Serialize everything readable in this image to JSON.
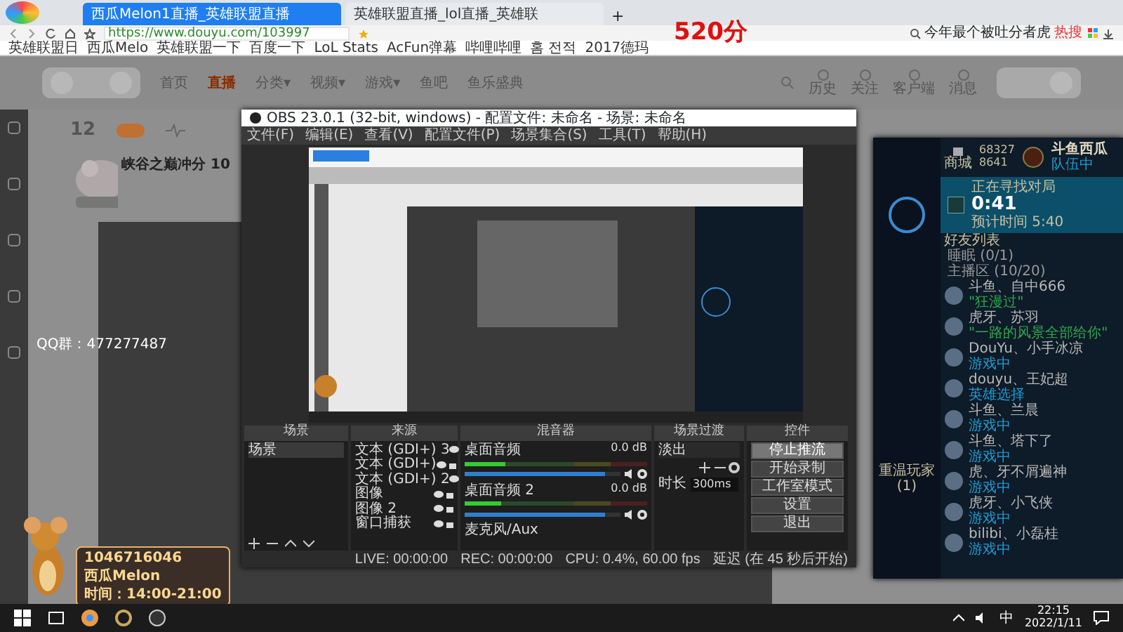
{
  "browser": {
    "tabs": [
      {
        "label": "西瓜Melon1直播_英雄联盟直播",
        "selected": true
      },
      {
        "label": "英雄联盟直播_lol直播_英雄联",
        "selected": false
      }
    ],
    "new_tab": "+",
    "url": "https://www.douyu.com/103997",
    "search": "今年最个被吐分者虎",
    "search_badge": "热搜",
    "bookmarks": [
      "英雄联盟日",
      "西瓜Melo",
      "英雄联盟一下",
      "百度一下",
      "LoL Stats",
      "AcFun弹幕",
      "哔哩哔哩",
      "홈 전적",
      "2017德玛"
    ]
  },
  "overlay_score": "520分",
  "site": {
    "nav": [
      {
        "label": "首页",
        "selected": false
      },
      {
        "label": "直播",
        "selected": true
      },
      {
        "label": "分类▾",
        "selected": false
      },
      {
        "label": "视频▾",
        "selected": false
      },
      {
        "label": "游戏▾",
        "selected": false
      },
      {
        "label": "鱼吧",
        "selected": false
      },
      {
        "label": "鱼乐盛典",
        "selected": false
      }
    ],
    "header_links": [
      "历史",
      "关注",
      "客户端",
      "消息"
    ],
    "follow_count": "12",
    "room_title": "峡谷之巅冲分 10",
    "qq_group": "QQ群：477277487",
    "info_card": [
      "1046716046",
      "西瓜Melon",
      "时间：14:00-21:00"
    ]
  },
  "obs": {
    "title": "OBS 23.0.1 (32-bit, windows) - 配置文件: 未命名 - 场景: 未命名",
    "menu": [
      "文件(F)",
      "编辑(E)",
      "查看(V)",
      "配置文件(P)",
      "场景集合(S)",
      "工具(T)",
      "帮助(H)"
    ],
    "scenes": {
      "title": "场景",
      "items": [
        {
          "label": "场景",
          "selected": true
        }
      ]
    },
    "sources": {
      "title": "来源",
      "items": [
        "文本 (GDI+) 3",
        "文本 (GDI+)",
        "文本 (GDI+) 2",
        "图像",
        "图像 2",
        "窗口捕获"
      ]
    },
    "mixer": {
      "title": "混音器",
      "channels": [
        {
          "name": "桌面音频",
          "reading": "0.0 dB",
          "level": 0.22,
          "volume_slider": {
            "level": 0.9
          }
        },
        {
          "name": "桌面音频 2",
          "reading": "0.0 dB",
          "level": 0.2,
          "volume_slider": {
            "level": 0.9
          }
        }
      ],
      "more": "麦克风/Aux"
    },
    "transitions": {
      "title": "场景过渡",
      "value": "淡出",
      "duration_label": "时长",
      "duration": "300ms"
    },
    "controls": {
      "title": "控件",
      "buttons": [
        {
          "label": "停止推流",
          "active": true
        },
        {
          "label": "开始录制",
          "active": false
        },
        {
          "label": "工作室模式",
          "active": false
        },
        {
          "label": "设置",
          "active": false
        },
        {
          "label": "退出",
          "active": false
        }
      ]
    },
    "status": [
      "LIVE: 00:00:00",
      "REC: 00:00:00",
      "CPU: 0.4%, 60.00 fps",
      "延迟 (在 45 秒后开始)"
    ]
  },
  "lol": {
    "store": "商城",
    "blue_essence": "68327",
    "riot_points": "8641",
    "summoner": "斗鱼西瓜",
    "summoner_status": "队伍中",
    "queue_title": "正在寻找对局",
    "queue_time": "0:41",
    "queue_estimate": "预计时间 5:40",
    "friends_title": "好友列表",
    "groups": [
      "睡眠 (0/1)",
      "主播区 (10/20)"
    ],
    "party_label": "重温玩家 (1)",
    "friends": [
      {
        "name": "斗鱼、自中666",
        "status": "\"狂漫过\"",
        "color": "#2fa84f"
      },
      {
        "name": "虎牙、苏羽",
        "status": "\"一路的风景全部给你\"",
        "color": "#2fa84f"
      },
      {
        "name": "DouYu、小手冰凉",
        "status": "游戏中",
        "color": "#1a9fd8"
      },
      {
        "name": "douyu、王妃超",
        "status": "英雄选择",
        "color": "#1a9fd8"
      },
      {
        "name": "斗鱼、兰晨",
        "status": "游戏中",
        "color": "#1a9fd8"
      },
      {
        "name": "斗鱼、塔下了",
        "status": "游戏中",
        "color": "#1a9fd8"
      },
      {
        "name": "虎、牙不屑遍神",
        "status": "游戏中",
        "color": "#1a9fd8"
      },
      {
        "name": "虎牙、小飞侠",
        "status": "游戏中",
        "color": "#1a9fd8"
      },
      {
        "name": "bilibi、小磊桂",
        "status": "游戏中",
        "color": "#1a9fd8"
      }
    ]
  },
  "taskbar": {
    "ime": "中",
    "time": "22:15",
    "date": "2022/1/11"
  }
}
